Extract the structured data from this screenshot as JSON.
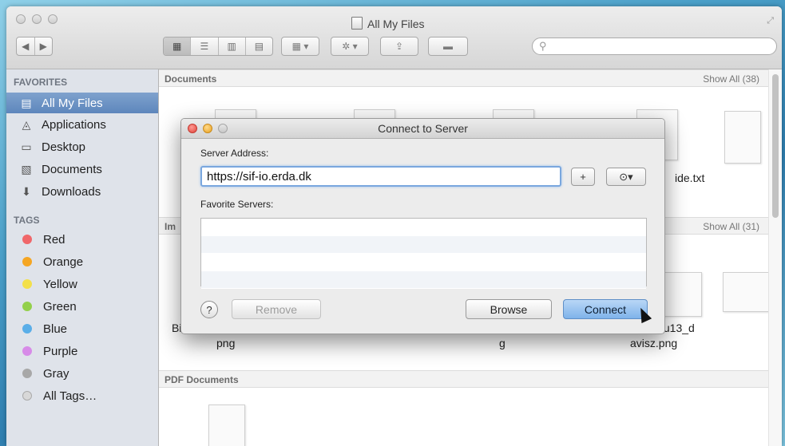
{
  "window": {
    "title": "All My Files"
  },
  "toolbar": {
    "back": "◀",
    "forward": "▶",
    "search_placeholder": ""
  },
  "sidebar": {
    "favorites_header": "FAVORITES",
    "favorites": [
      {
        "label": "All My Files",
        "icon": "all-files-icon",
        "selected": true
      },
      {
        "label": "Applications",
        "icon": "applications-icon"
      },
      {
        "label": "Desktop",
        "icon": "desktop-icon"
      },
      {
        "label": "Documents",
        "icon": "documents-icon"
      },
      {
        "label": "Downloads",
        "icon": "downloads-icon"
      }
    ],
    "tags_header": "TAGS",
    "tags": [
      {
        "label": "Red",
        "color": "#f0676a"
      },
      {
        "label": "Orange",
        "color": "#f5a623"
      },
      {
        "label": "Yellow",
        "color": "#f3e04a"
      },
      {
        "label": "Green",
        "color": "#93d04b"
      },
      {
        "label": "Blue",
        "color": "#5aaee8"
      },
      {
        "label": "Purple",
        "color": "#d78be8"
      },
      {
        "label": "Gray",
        "color": "#a8a8a8"
      },
      {
        "label": "All Tags…",
        "color": "#d8d8d8"
      }
    ]
  },
  "sections": {
    "documents": {
      "title": "Documents",
      "show_all": "Show All (38)"
    },
    "images": {
      "title": "Im",
      "show_all": "Show All (31)"
    },
    "pdf": {
      "title": "PDF Documents"
    }
  },
  "files": {
    "doc_label": "ide.txt",
    "img_label_1_prefix": "Bi",
    "img_label_1": "png",
    "img_label_2": "g",
    "img_label_3a": "tu13_d",
    "img_label_3b": "avisz.png"
  },
  "dialog": {
    "title": "Connect to Server",
    "server_address_label": "Server Address:",
    "server_address_value": "https://sif-io.erda.dk",
    "add_label": "+",
    "recent_label": "⊙▾",
    "favorite_servers_label": "Favorite Servers:",
    "help_label": "?",
    "remove_label": "Remove",
    "browse_label": "Browse",
    "connect_label": "Connect"
  }
}
